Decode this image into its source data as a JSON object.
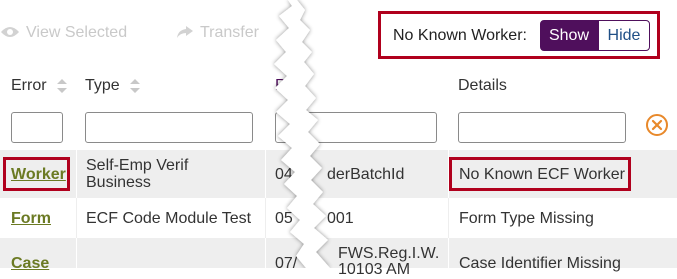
{
  "toolbar": {
    "view_selected_label": "View Selected",
    "transfer_label": "Transfer"
  },
  "no_known_worker": {
    "label": "No Known Worker:",
    "show_label": "Show",
    "hide_label": "Hide",
    "selected": "Show"
  },
  "columns": {
    "error": "Error",
    "type": "Type",
    "reference": "Re",
    "details": "Details"
  },
  "rows": [
    {
      "error": "Worker",
      "type_line1": "Self-Emp Verif",
      "type_line2": "Business",
      "reference": "04",
      "reference_tail": "derBatchId",
      "details": "No Known ECF Worker"
    },
    {
      "error": "Form",
      "type_line1": "ECF Code Module Test",
      "type_line2": "",
      "reference": "05",
      "reference_tail": "001",
      "details": "Form Type Missing"
    },
    {
      "error": "Case",
      "type_line1": "",
      "type_line2": "",
      "reference": "07/",
      "reference_tail": "FWS.Reg.I.W.",
      "reference_tail2": "10103 AM",
      "details": "Case Identifier Missing"
    }
  ],
  "colors": {
    "accent_purple": "#4f0f5c",
    "highlight_red": "#b0001d",
    "link_olive": "#6b7a23",
    "clear_icon_orange": "#e8892b",
    "row_alt": "#eeeeee"
  }
}
